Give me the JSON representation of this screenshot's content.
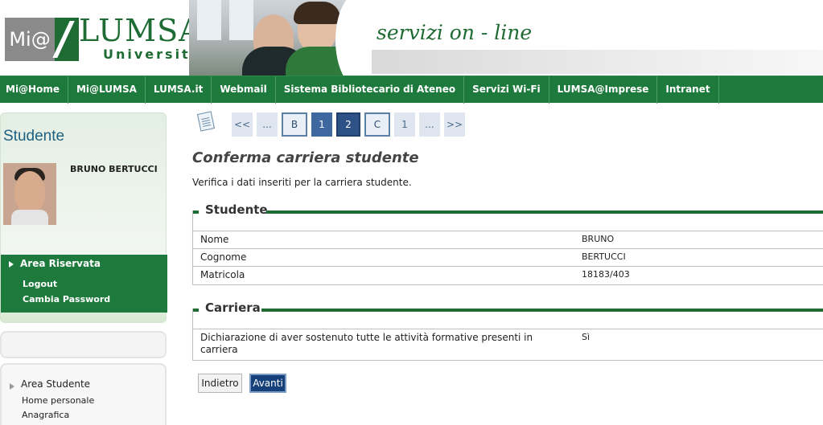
{
  "header": {
    "logo_mi": "Mi@",
    "logo_lumsa": "LUMSA",
    "logo_universita": "Università",
    "tagline": "servizi on - line"
  },
  "nav": {
    "items": [
      "Mi@Home",
      "Mi@LUMSA",
      "LUMSA.it",
      "Webmail",
      "Sistema Bibliotecario di Ateneo",
      "Servizi Wi-Fi",
      "LUMSA@Imprese",
      "Intranet"
    ]
  },
  "sidebar": {
    "title": "Studente",
    "student_name": "BRUNO BERTUCCI",
    "area_riservata": {
      "title": "Area Riservata",
      "links": [
        "Logout",
        "Cambia Password"
      ]
    },
    "area_studente": {
      "title": "Area Studente",
      "links": [
        "Home personale",
        "Anagrafica"
      ]
    }
  },
  "pager": {
    "items": [
      "<<",
      "...",
      "B",
      "1",
      "2",
      "C",
      "1",
      "...",
      ">>"
    ],
    "current": "2"
  },
  "main": {
    "title": "Conferma carriera studente",
    "description": "Verifica i dati inseriti per la carriera studente.",
    "sections": [
      {
        "title": "Studente",
        "rows": [
          {
            "label": "Nome",
            "value": "BRUNO"
          },
          {
            "label": "Cognome",
            "value": "BERTUCCI"
          },
          {
            "label": "Matricola",
            "value": "18183/403"
          }
        ]
      },
      {
        "title": "Carriera",
        "rows": [
          {
            "label": "Dichiarazione di aver sostenuto tutte le attività formative presenti in carriera",
            "value": "Sì"
          }
        ]
      }
    ],
    "buttons": {
      "back": "Indietro",
      "next": "Avanti"
    }
  }
}
